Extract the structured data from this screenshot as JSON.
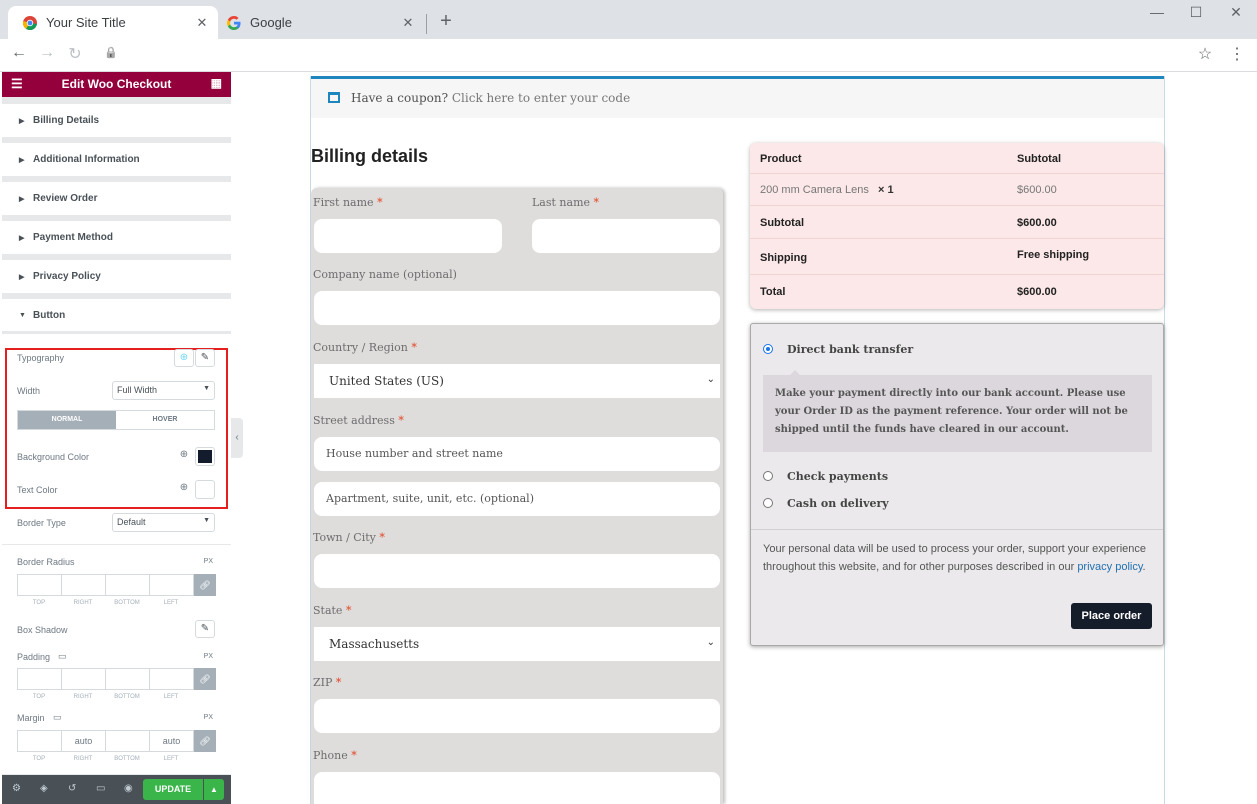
{
  "browser": {
    "tabs": [
      {
        "title": "Your Site Title",
        "close": "✕"
      },
      {
        "title": "Google",
        "close": "✕"
      }
    ],
    "new_tab": "+",
    "window": {
      "minimize": "—",
      "maximize": "☐",
      "close": "✕"
    },
    "nav": {
      "back": "←",
      "forward": "→",
      "reload": "↻",
      "lock": "🔒",
      "star": "☆",
      "menu": "⋮"
    }
  },
  "panel": {
    "title": "Edit Woo Checkout",
    "sections": [
      "Billing Details",
      "Additional Information",
      "Review Order",
      "Payment Method",
      "Privacy Policy"
    ],
    "open_section": "Button",
    "controls": {
      "typography": "Typography",
      "width": "Width",
      "width_value": "Full Width",
      "tabs": [
        "NORMAL",
        "HOVER"
      ],
      "bg_color": "Background Color",
      "bg_color_value": "#131c2c",
      "text_color": "Text Color",
      "border_type": "Border Type",
      "border_type_value": "Default",
      "border_radius": "Border Radius",
      "unit": "PX",
      "dims": [
        "TOP",
        "RIGHT",
        "BOTTOM",
        "LEFT"
      ],
      "box_shadow": "Box Shadow",
      "padding": "Padding",
      "margin": "Margin",
      "margin_values": [
        "",
        "auto",
        "",
        "auto"
      ]
    },
    "footer": {
      "update": "UPDATE",
      "update_arrow": "▲"
    }
  },
  "page": {
    "coupon": {
      "text": "Have a coupon?",
      "link": "Click here to enter your code"
    },
    "billing_heading": "Billing details",
    "fields": {
      "first_name": "First name",
      "last_name": "Last name",
      "company": "Company name (optional)",
      "country": "Country / Region",
      "country_value": "United States (US)",
      "street": "Street address",
      "street_ph1": "House number and street name",
      "street_ph2": "Apartment, suite, unit, etc. (optional)",
      "town": "Town / City",
      "state": "State",
      "state_value": "Massachusetts",
      "zip": "ZIP",
      "phone": "Phone",
      "req": "*"
    },
    "order": {
      "head_product": "Product",
      "head_subtotal": "Subtotal",
      "item_name": "200 mm Camera Lens",
      "item_qty": "× 1",
      "item_price": "$600.00",
      "subtotal_label": "Subtotal",
      "subtotal_value": "$600.00",
      "shipping_label": "Shipping",
      "shipping_value": "Free shipping",
      "total_label": "Total",
      "total_value": "$600.00"
    },
    "payment": {
      "methods": [
        "Direct bank transfer",
        "Check payments",
        "Cash on delivery"
      ],
      "description": "Make your payment directly into our bank account. Please use your Order ID as the payment reference. Your order will not be shipped until the funds have cleared in our account.",
      "privacy_text": "Your personal data will be used to process your order, support your experience throughout this website, and for other purposes described in our",
      "privacy_link": "privacy policy",
      "place_order": "Place order"
    }
  }
}
